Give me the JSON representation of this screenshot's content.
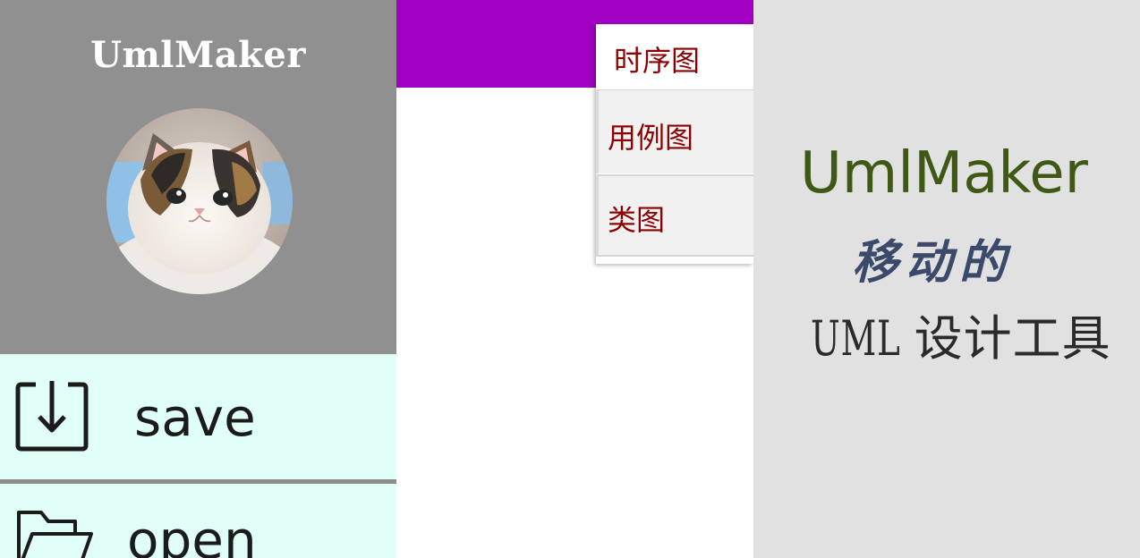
{
  "drawer": {
    "app_title": "UmlMaker",
    "avatar_alt": "avatar",
    "menu": [
      {
        "label": "save",
        "icon": "download-icon"
      },
      {
        "label": "open",
        "icon": "folder-icon"
      }
    ]
  },
  "content": {
    "toolbar_color": "#a100c2",
    "popup_menu": [
      {
        "label": "时序图"
      },
      {
        "label": "用例图"
      },
      {
        "label": "类图"
      }
    ]
  },
  "splash": {
    "title": "UmlMaker",
    "line2": "移动的",
    "line3_latin": "UML",
    "line3_cjk": "设计工具"
  },
  "colors": {
    "drawer_header_bg": "#909090",
    "drawer_menu_bg": "#e0fff7",
    "popup_text": "#8b0000",
    "splash_bg": "#e1e1e1",
    "splash_title": "#3f5815"
  }
}
